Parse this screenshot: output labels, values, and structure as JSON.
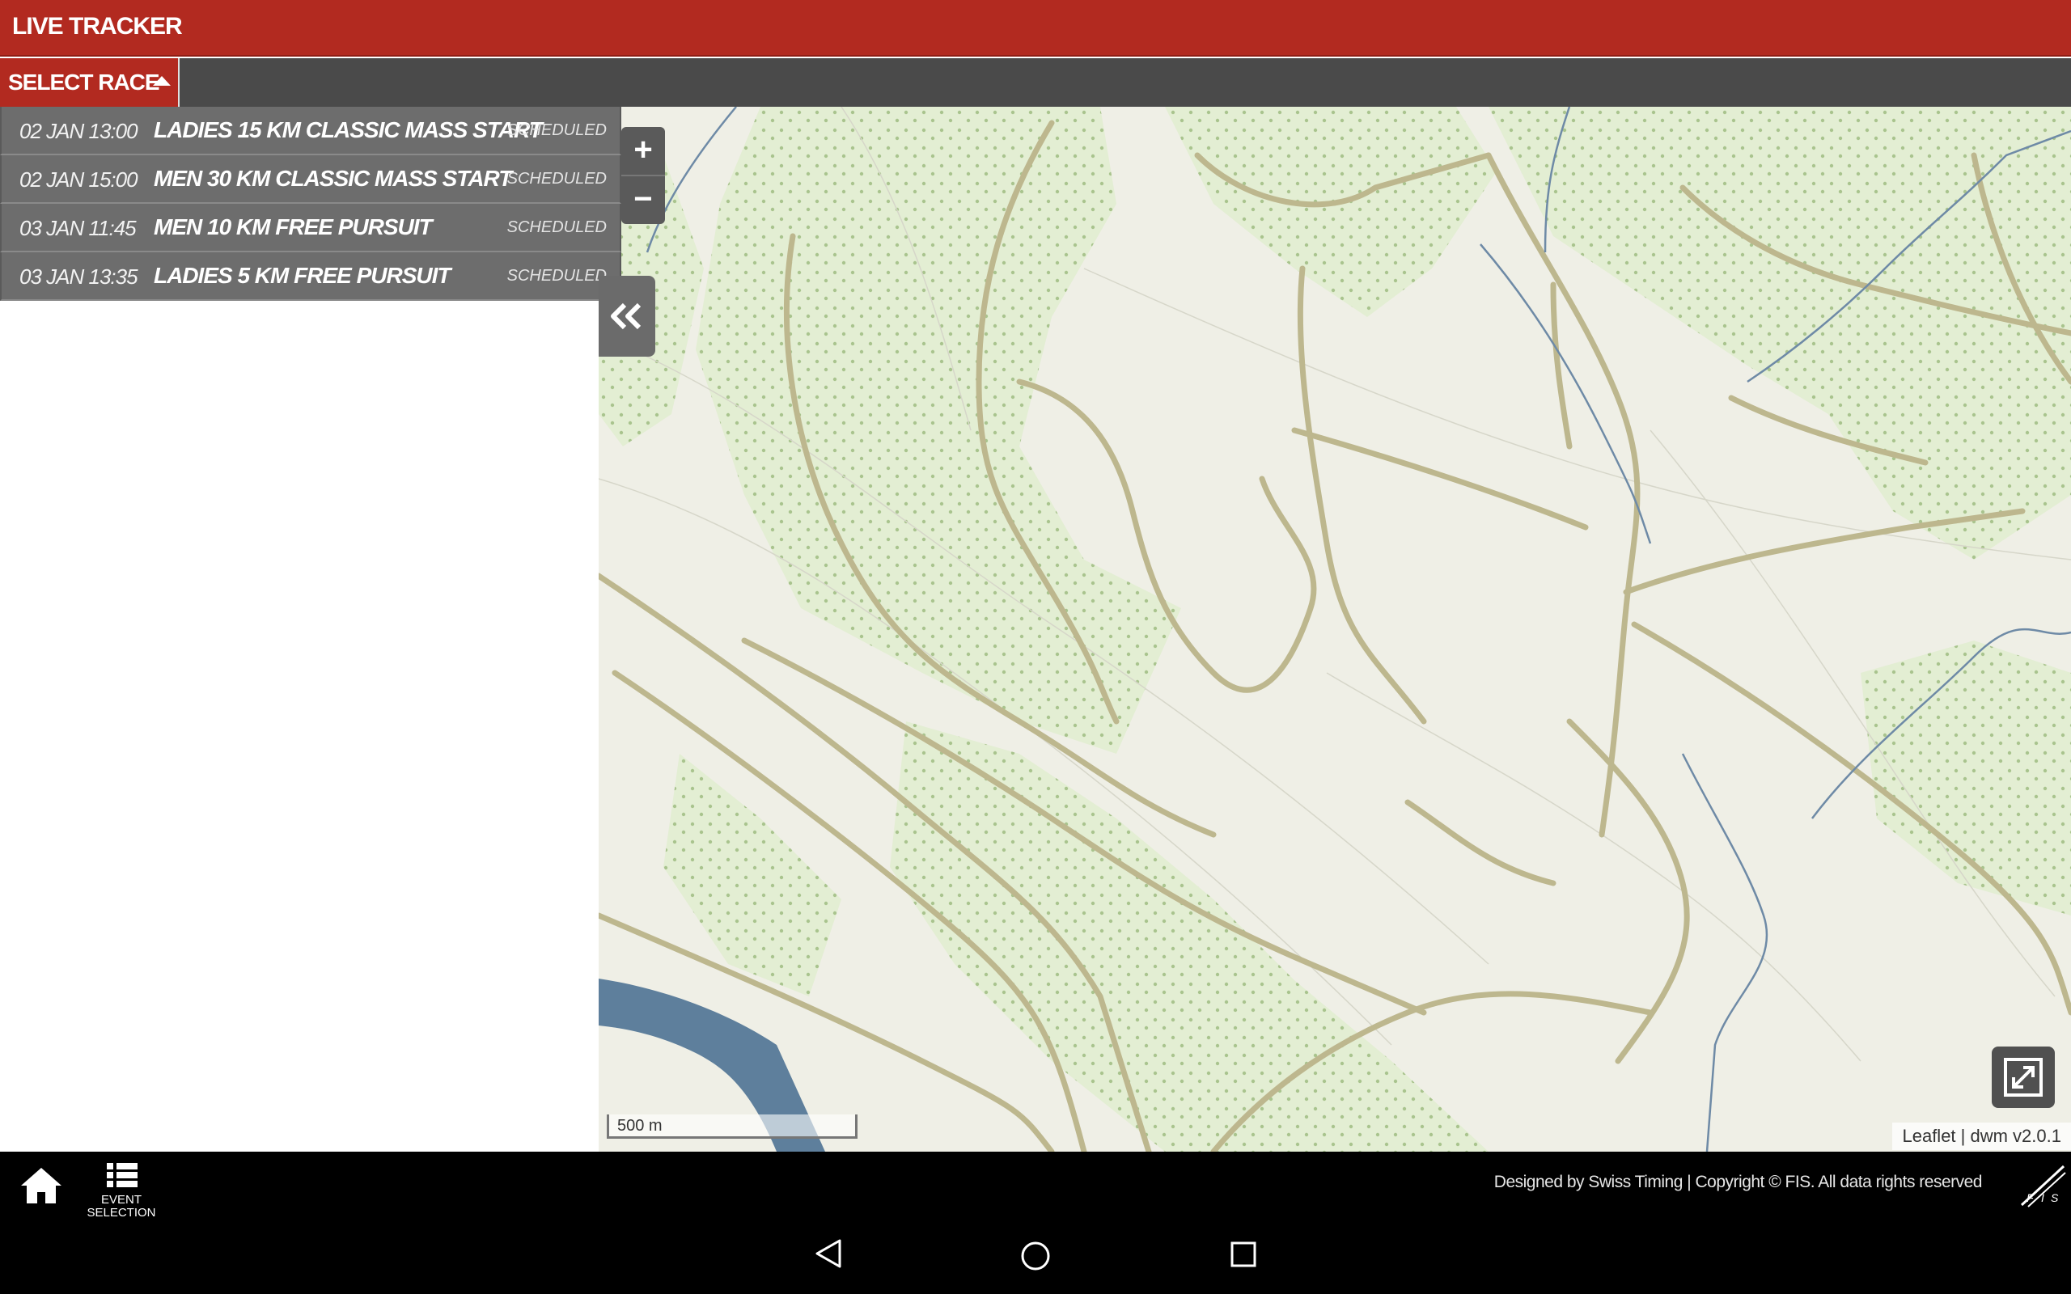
{
  "header": {
    "title": "LIVE TRACKER"
  },
  "race_bar": {
    "select_label": "SELECT RACE"
  },
  "races": [
    {
      "time": "02 JAN 13:00",
      "name": "LADIES 15 KM CLASSIC MASS START",
      "status": "SCHEDULED"
    },
    {
      "time": "02 JAN 15:00",
      "name": "MEN 30 KM CLASSIC MASS START",
      "status": "SCHEDULED"
    },
    {
      "time": "03 JAN 11:45",
      "name": "MEN 10 KM FREE PURSUIT",
      "status": "SCHEDULED"
    },
    {
      "time": "03 JAN 13:35",
      "name": "LADIES 5 KM FREE PURSUIT",
      "status": "SCHEDULED"
    }
  ],
  "map": {
    "zoom_in": "+",
    "zoom_out": "−",
    "scale_label": "500 m",
    "attribution_leaflet": "Leaflet",
    "attribution_sep": " | ",
    "attribution_version": "dwm v2.0.1"
  },
  "footer": {
    "event_selection_label_1": "EVENT",
    "event_selection_label_2": "SELECTION",
    "copyright": "Designed by Swiss Timing | Copyright © FIS. All data rights reserved"
  },
  "icons": {
    "home": "home-icon",
    "event_selection": "list-icon",
    "collapse": "double-chevron-left-icon",
    "fullscreen": "fullscreen-icon",
    "logo": "fis-logo",
    "nav_back": "triangle-back-icon",
    "nav_home": "circle-home-icon",
    "nav_recent": "square-recent-icon"
  },
  "colors": {
    "header_red": "#b22a20",
    "race_row_gray": "#6d6d6d",
    "map_background": "#efefe6",
    "forest_green": "#dfeccc",
    "road_tan": "#b9b58a",
    "river_blue": "#5e7f9c"
  }
}
